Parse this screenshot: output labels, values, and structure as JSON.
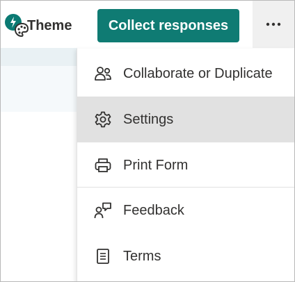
{
  "toolbar": {
    "theme_label": "Theme",
    "collect_label": "Collect responses",
    "more_icon": "more-horizontal-icon",
    "accent_color": "#0f7b73"
  },
  "menu": {
    "items": [
      {
        "label": "Collaborate or Duplicate",
        "icon": "people-icon"
      },
      {
        "label": "Settings",
        "icon": "gear-icon",
        "selected": true
      },
      {
        "label": "Print Form",
        "icon": "printer-icon"
      },
      {
        "label": "Feedback",
        "icon": "feedback-icon"
      },
      {
        "label": "Terms",
        "icon": "document-icon"
      }
    ]
  }
}
